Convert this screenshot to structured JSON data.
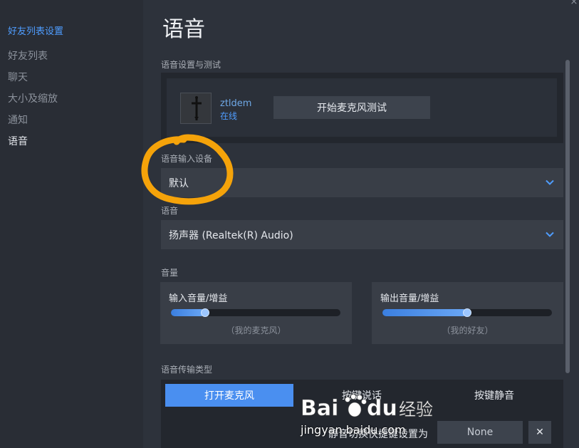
{
  "sidebar": {
    "title": "好友列表设置",
    "items": [
      {
        "label": "好友列表",
        "active": false
      },
      {
        "label": "聊天",
        "active": false
      },
      {
        "label": "大小及缩放",
        "active": false
      },
      {
        "label": "通知",
        "active": false
      },
      {
        "label": "语音",
        "active": true
      }
    ]
  },
  "main": {
    "title": "语音",
    "test_section": {
      "label": "语音设置与测试",
      "username": "ztldem",
      "status": "在线",
      "button_label": "开始麦克风测试"
    },
    "input_device": {
      "label": "语音输入设备",
      "value": "默认"
    },
    "output_device": {
      "label": "语音",
      "value": "扬声器 (Realtek(R) Audio)"
    },
    "volume": {
      "label": "音量",
      "input": {
        "title": "输入音量/增益",
        "caption": "（我的麦克风）",
        "level": 0.2
      },
      "output": {
        "title": "输出音量/增益",
        "caption": "（我的好友）",
        "level": 0.5
      }
    },
    "transmission": {
      "label": "语音传输类型",
      "options": [
        "打开麦克风",
        "按键说话",
        "按键静音"
      ],
      "selected": "打开麦克风",
      "hotkey_label": "静音切换快捷键设置为",
      "hotkey_value": "None",
      "clear_label": "✕"
    }
  },
  "watermark": {
    "brand": "Bai du 经验",
    "url": "jingyan.baidu.com"
  },
  "colors": {
    "accent": "#4a8ff0",
    "annotation": "#f5a30a"
  }
}
